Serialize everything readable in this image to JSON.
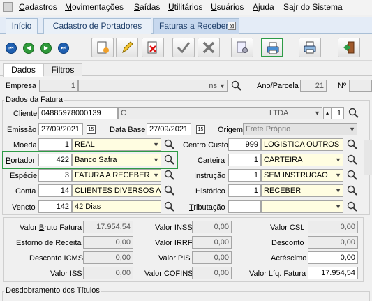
{
  "menu": {
    "items": [
      "Cadastros",
      "Movimentações",
      "Saídas",
      "Utilitários",
      "Usuários",
      "Ajuda",
      "Sajr do Sistema"
    ],
    "underline": [
      "C",
      "M",
      "S",
      "U",
      "U",
      "A",
      ""
    ]
  },
  "tabs": [
    {
      "label": "Início"
    },
    {
      "label": "Cadastro de Portadores"
    },
    {
      "label": "Faturas a Receber"
    }
  ],
  "tab_close": "⊠",
  "subtabs": [
    {
      "label": "Dados"
    },
    {
      "label": "Filtros"
    }
  ],
  "header": {
    "empresa_label": "Empresa",
    "empresa_value": "1",
    "empresa_name": "ns",
    "ano_parcela_label": "Ano/Parcela",
    "ano_parcela_value": "21",
    "numero_label": "Nº",
    "numero_value": ""
  },
  "fatura": {
    "group_title": "Dados da Fatura",
    "cliente_label": "Cliente",
    "cliente_code": "04885978000139",
    "cliente_name_start": "C",
    "cliente_name_end": "LTDA",
    "cliente_seq": "1",
    "emissao_label": "Emissão",
    "emissao_value": "27/09/2021",
    "database_label": "Data Base",
    "database_value": "27/09/2021",
    "origem_label": "Origem",
    "origem_value": "Frete Próprio",
    "moeda_label": "Moeda",
    "moeda_code": "1",
    "moeda_name": "REAL",
    "centro_custo_label": "Centro Custo",
    "centro_custo_code": "999",
    "centro_custo_name": "LOGISTICA OUTROS",
    "portador_label": "Portador",
    "portador_code": "422",
    "portador_name": "Banco Safra",
    "carteira_label": "Carteira",
    "carteira_code": "1",
    "carteira_name": "CARTEIRA",
    "especie_label": "Espécie",
    "especie_code": "3",
    "especie_name": "FATURA A RECEBER",
    "instrucao_label": "Instrução",
    "instrucao_code": "1",
    "instrucao_name": "SEM INSTRUCAO",
    "conta_label": "Conta",
    "conta_code": "14",
    "conta_name": "CLIENTES DIVERSOS A",
    "historico_label": "Histórico",
    "historico_code": "1",
    "historico_name": "RECEBER",
    "vencto_label": "Vencto",
    "vencto_code": "142",
    "vencto_name": "42 Dias",
    "tributacao_label": "Tributação",
    "tributacao_code": "",
    "tributacao_name": ""
  },
  "valores": {
    "bruto_label": "Valor Bruto Fatura",
    "bruto_value": "17.954,54",
    "inss_label": "Valor INSS",
    "inss_value": "0,00",
    "csl_label": "Valor CSL",
    "csl_value": "0,00",
    "estorno_label": "Estorno de Receita",
    "estorno_value": "0,00",
    "irrf_label": "Valor IRRF",
    "irrf_value": "0,00",
    "desconto_label": "Desconto",
    "desconto_value": "0,00",
    "desconto_icms_label": "Desconto ICMS",
    "desconto_icms_value": "0,00",
    "pis_label": "Valor PIS",
    "pis_value": "0,00",
    "acrescimo_label": "Acréscimo",
    "acrescimo_value": "0,00",
    "iss_label": "Valor ISS",
    "iss_value": "0,00",
    "cofins_label": "Valor COFINS",
    "cofins_value": "0,00",
    "liquida_label": "Valor Líq. Fatura",
    "liquida_value": "17.954,54"
  },
  "desdobramento_title": "Desdobramento dos Títulos",
  "colors": {
    "highlight": "#2e9b46",
    "tab_active": "#c7d8ee",
    "lookup_bg": "#fffde1"
  }
}
